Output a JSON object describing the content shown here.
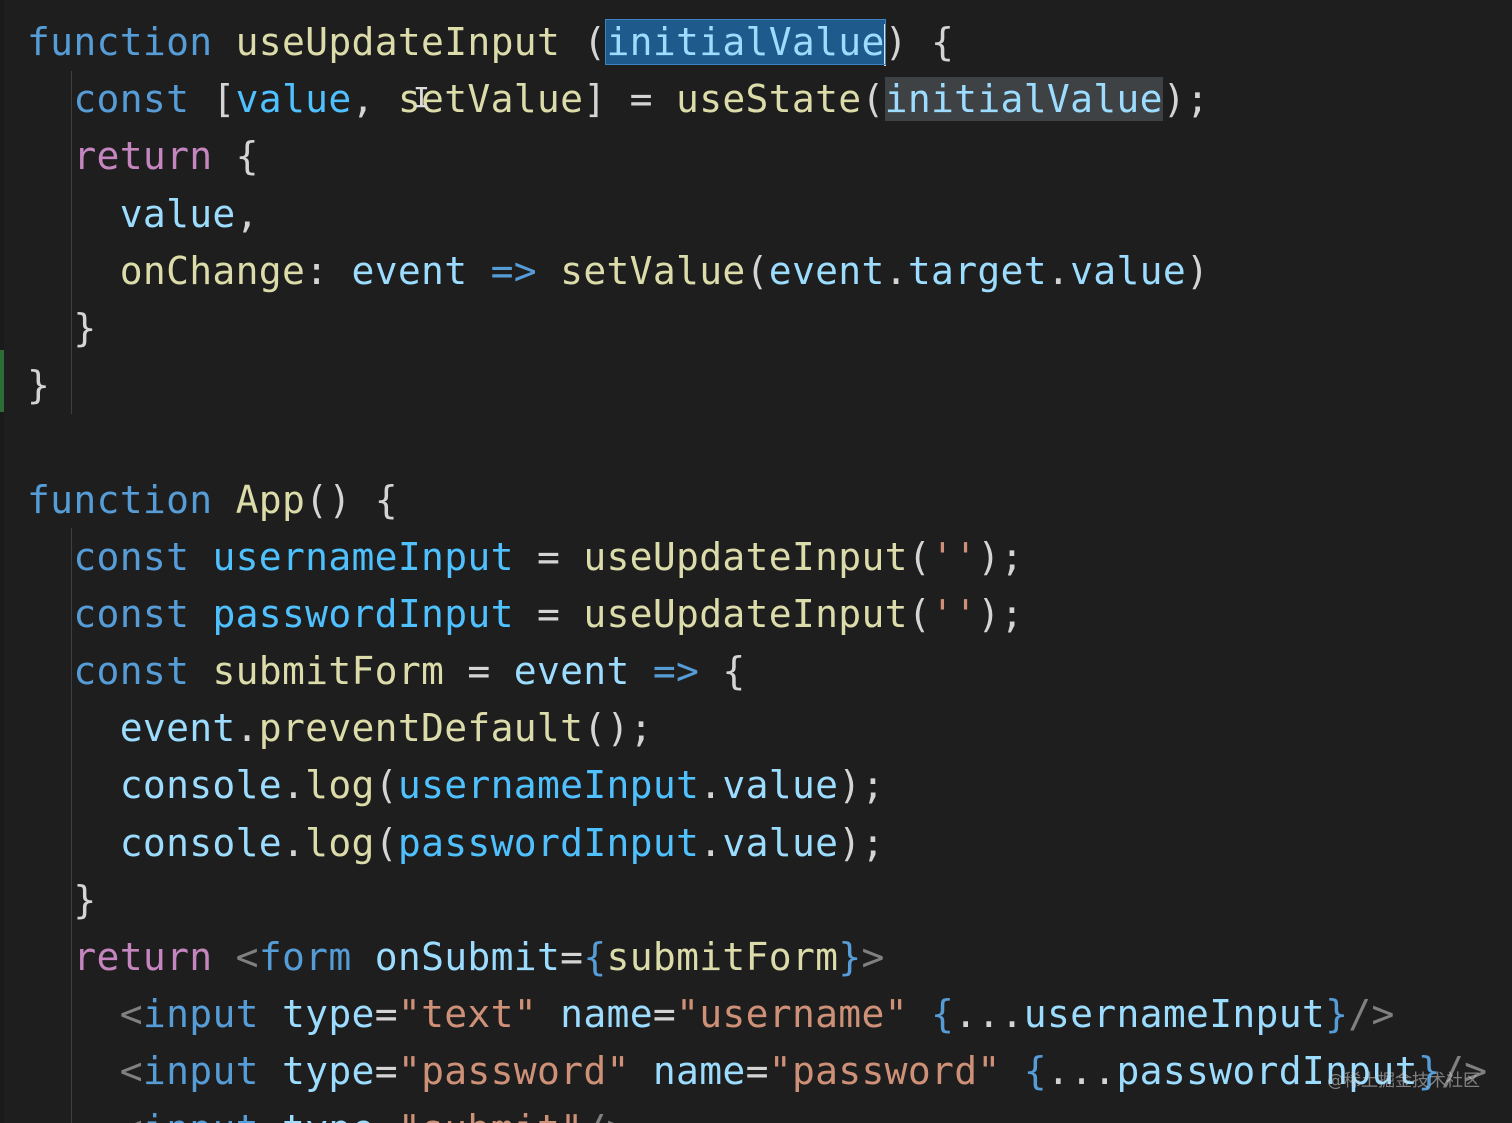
{
  "editor": {
    "theme_colors": {
      "background": "#1e1e1e",
      "keyword": "#569cd6",
      "control": "#c586c0",
      "function": "#dcdcaa",
      "variable": "#9cdcfe",
      "constant": "#4fc1ff",
      "string": "#ce9178",
      "text": "#d4d4d4",
      "selection": "#1f5a8c",
      "occurrence_highlight": "#3f4245",
      "git_added_marker": "#2e6e36"
    },
    "cursor_icon": "text-ibeam-cursor",
    "lines": [
      [
        {
          "t": "function",
          "c": "#569cd6"
        },
        {
          "t": " ",
          "c": "#d4d4d4"
        },
        {
          "t": "useUpdateInput",
          "c": "#dcdcaa"
        },
        {
          "t": " (",
          "c": "#d4d4d4"
        },
        {
          "t": "initialValue",
          "c": "#9cdcfe",
          "hl": "sel",
          "caret": true
        },
        {
          "t": ") {",
          "c": "#d4d4d4"
        }
      ],
      [
        {
          "t": "  ",
          "c": "#d4d4d4"
        },
        {
          "t": "const",
          "c": "#569cd6"
        },
        {
          "t": " [",
          "c": "#d4d4d4"
        },
        {
          "t": "value",
          "c": "#4fc1ff"
        },
        {
          "t": ", ",
          "c": "#d4d4d4"
        },
        {
          "t": "setValue",
          "c": "#dcdcaa"
        },
        {
          "t": "] = ",
          "c": "#d4d4d4"
        },
        {
          "t": "useState",
          "c": "#dcdcaa"
        },
        {
          "t": "(",
          "c": "#d4d4d4"
        },
        {
          "t": "initialValue",
          "c": "#9cdcfe",
          "hl": "occ"
        },
        {
          "t": ");",
          "c": "#d4d4d4"
        }
      ],
      [
        {
          "t": "  ",
          "c": "#d4d4d4"
        },
        {
          "t": "return",
          "c": "#c586c0"
        },
        {
          "t": " {",
          "c": "#d4d4d4"
        }
      ],
      [
        {
          "t": "    ",
          "c": "#d4d4d4"
        },
        {
          "t": "value",
          "c": "#9cdcfe"
        },
        {
          "t": ",",
          "c": "#d4d4d4"
        }
      ],
      [
        {
          "t": "    ",
          "c": "#d4d4d4"
        },
        {
          "t": "onChange",
          "c": "#dcdcaa"
        },
        {
          "t": ": ",
          "c": "#d4d4d4"
        },
        {
          "t": "event",
          "c": "#9cdcfe"
        },
        {
          "t": " ",
          "c": "#d4d4d4"
        },
        {
          "t": "=>",
          "c": "#569cd6"
        },
        {
          "t": " ",
          "c": "#d4d4d4"
        },
        {
          "t": "setValue",
          "c": "#dcdcaa"
        },
        {
          "t": "(",
          "c": "#d4d4d4"
        },
        {
          "t": "event",
          "c": "#9cdcfe"
        },
        {
          "t": ".",
          "c": "#d4d4d4"
        },
        {
          "t": "target",
          "c": "#9cdcfe"
        },
        {
          "t": ".",
          "c": "#d4d4d4"
        },
        {
          "t": "value",
          "c": "#9cdcfe"
        },
        {
          "t": ")",
          "c": "#d4d4d4"
        }
      ],
      [
        {
          "t": "  }",
          "c": "#d4d4d4"
        }
      ],
      [
        {
          "t": "}",
          "c": "#d4d4d4"
        }
      ],
      [
        {
          "t": "",
          "c": "#d4d4d4"
        }
      ],
      [
        {
          "t": "function",
          "c": "#569cd6"
        },
        {
          "t": " ",
          "c": "#d4d4d4"
        },
        {
          "t": "App",
          "c": "#dcdcaa"
        },
        {
          "t": "() {",
          "c": "#d4d4d4"
        }
      ],
      [
        {
          "t": "  ",
          "c": "#d4d4d4"
        },
        {
          "t": "const",
          "c": "#569cd6"
        },
        {
          "t": " ",
          "c": "#d4d4d4"
        },
        {
          "t": "usernameInput",
          "c": "#4fc1ff"
        },
        {
          "t": " = ",
          "c": "#d4d4d4"
        },
        {
          "t": "useUpdateInput",
          "c": "#dcdcaa"
        },
        {
          "t": "(",
          "c": "#d4d4d4"
        },
        {
          "t": "''",
          "c": "#ce9178"
        },
        {
          "t": ");",
          "c": "#d4d4d4"
        }
      ],
      [
        {
          "t": "  ",
          "c": "#d4d4d4"
        },
        {
          "t": "const",
          "c": "#569cd6"
        },
        {
          "t": " ",
          "c": "#d4d4d4"
        },
        {
          "t": "passwordInput",
          "c": "#4fc1ff"
        },
        {
          "t": " = ",
          "c": "#d4d4d4"
        },
        {
          "t": "useUpdateInput",
          "c": "#dcdcaa"
        },
        {
          "t": "(",
          "c": "#d4d4d4"
        },
        {
          "t": "''",
          "c": "#ce9178"
        },
        {
          "t": ");",
          "c": "#d4d4d4"
        }
      ],
      [
        {
          "t": "  ",
          "c": "#d4d4d4"
        },
        {
          "t": "const",
          "c": "#569cd6"
        },
        {
          "t": " ",
          "c": "#d4d4d4"
        },
        {
          "t": "submitForm",
          "c": "#dcdcaa"
        },
        {
          "t": " = ",
          "c": "#d4d4d4"
        },
        {
          "t": "event",
          "c": "#9cdcfe"
        },
        {
          "t": " ",
          "c": "#d4d4d4"
        },
        {
          "t": "=>",
          "c": "#569cd6"
        },
        {
          "t": " {",
          "c": "#d4d4d4"
        }
      ],
      [
        {
          "t": "    ",
          "c": "#d4d4d4"
        },
        {
          "t": "event",
          "c": "#9cdcfe"
        },
        {
          "t": ".",
          "c": "#d4d4d4"
        },
        {
          "t": "preventDefault",
          "c": "#dcdcaa"
        },
        {
          "t": "();",
          "c": "#d4d4d4"
        }
      ],
      [
        {
          "t": "    ",
          "c": "#d4d4d4"
        },
        {
          "t": "console",
          "c": "#9cdcfe"
        },
        {
          "t": ".",
          "c": "#d4d4d4"
        },
        {
          "t": "log",
          "c": "#dcdcaa"
        },
        {
          "t": "(",
          "c": "#d4d4d4"
        },
        {
          "t": "usernameInput",
          "c": "#4fc1ff"
        },
        {
          "t": ".",
          "c": "#d4d4d4"
        },
        {
          "t": "value",
          "c": "#9cdcfe"
        },
        {
          "t": ");",
          "c": "#d4d4d4"
        }
      ],
      [
        {
          "t": "    ",
          "c": "#d4d4d4"
        },
        {
          "t": "console",
          "c": "#9cdcfe"
        },
        {
          "t": ".",
          "c": "#d4d4d4"
        },
        {
          "t": "log",
          "c": "#dcdcaa"
        },
        {
          "t": "(",
          "c": "#d4d4d4"
        },
        {
          "t": "passwordInput",
          "c": "#4fc1ff"
        },
        {
          "t": ".",
          "c": "#d4d4d4"
        },
        {
          "t": "value",
          "c": "#9cdcfe"
        },
        {
          "t": ");",
          "c": "#d4d4d4"
        }
      ],
      [
        {
          "t": "  }",
          "c": "#d4d4d4"
        }
      ],
      [
        {
          "t": "  ",
          "c": "#d4d4d4"
        },
        {
          "t": "return",
          "c": "#c586c0"
        },
        {
          "t": " ",
          "c": "#d4d4d4"
        },
        {
          "t": "<",
          "c": "#808080"
        },
        {
          "t": "form",
          "c": "#569cd6"
        },
        {
          "t": " ",
          "c": "#d4d4d4"
        },
        {
          "t": "onSubmit",
          "c": "#9cdcfe"
        },
        {
          "t": "=",
          "c": "#d4d4d4"
        },
        {
          "t": "{",
          "c": "#569cd6"
        },
        {
          "t": "submitForm",
          "c": "#dcdcaa"
        },
        {
          "t": "}",
          "c": "#569cd6"
        },
        {
          "t": ">",
          "c": "#808080"
        }
      ],
      [
        {
          "t": "    ",
          "c": "#d4d4d4"
        },
        {
          "t": "<",
          "c": "#808080"
        },
        {
          "t": "input",
          "c": "#569cd6"
        },
        {
          "t": " ",
          "c": "#d4d4d4"
        },
        {
          "t": "type",
          "c": "#9cdcfe"
        },
        {
          "t": "=",
          "c": "#d4d4d4"
        },
        {
          "t": "\"text\"",
          "c": "#ce9178"
        },
        {
          "t": " ",
          "c": "#d4d4d4"
        },
        {
          "t": "name",
          "c": "#9cdcfe"
        },
        {
          "t": "=",
          "c": "#d4d4d4"
        },
        {
          "t": "\"username\"",
          "c": "#ce9178"
        },
        {
          "t": " ",
          "c": "#d4d4d4"
        },
        {
          "t": "{",
          "c": "#569cd6"
        },
        {
          "t": "...",
          "c": "#d4d4d4"
        },
        {
          "t": "usernameInput",
          "c": "#9cdcfe"
        },
        {
          "t": "}",
          "c": "#569cd6"
        },
        {
          "t": "/>",
          "c": "#808080"
        }
      ],
      [
        {
          "t": "    ",
          "c": "#d4d4d4"
        },
        {
          "t": "<",
          "c": "#808080"
        },
        {
          "t": "input",
          "c": "#569cd6"
        },
        {
          "t": " ",
          "c": "#d4d4d4"
        },
        {
          "t": "type",
          "c": "#9cdcfe"
        },
        {
          "t": "=",
          "c": "#d4d4d4"
        },
        {
          "t": "\"password\"",
          "c": "#ce9178"
        },
        {
          "t": " ",
          "c": "#d4d4d4"
        },
        {
          "t": "name",
          "c": "#9cdcfe"
        },
        {
          "t": "=",
          "c": "#d4d4d4"
        },
        {
          "t": "\"password\"",
          "c": "#ce9178"
        },
        {
          "t": " ",
          "c": "#d4d4d4"
        },
        {
          "t": "{",
          "c": "#569cd6"
        },
        {
          "t": "...",
          "c": "#d4d4d4"
        },
        {
          "t": "passwordInput",
          "c": "#9cdcfe"
        },
        {
          "t": "}",
          "c": "#569cd6"
        },
        {
          "t": "/>",
          "c": "#808080"
        }
      ],
      [
        {
          "t": "    ",
          "c": "#d4d4d4"
        },
        {
          "t": "<",
          "c": "#808080"
        },
        {
          "t": "input",
          "c": "#569cd6"
        },
        {
          "t": " ",
          "c": "#d4d4d4"
        },
        {
          "t": "type",
          "c": "#9cdcfe"
        },
        {
          "t": "=",
          "c": "#d4d4d4"
        },
        {
          "t": "\"submit\"",
          "c": "#ce9178"
        },
        {
          "t": "/>",
          "c": "#808080"
        }
      ]
    ]
  },
  "watermark": {
    "text": "@稀土掘金技术社区"
  }
}
